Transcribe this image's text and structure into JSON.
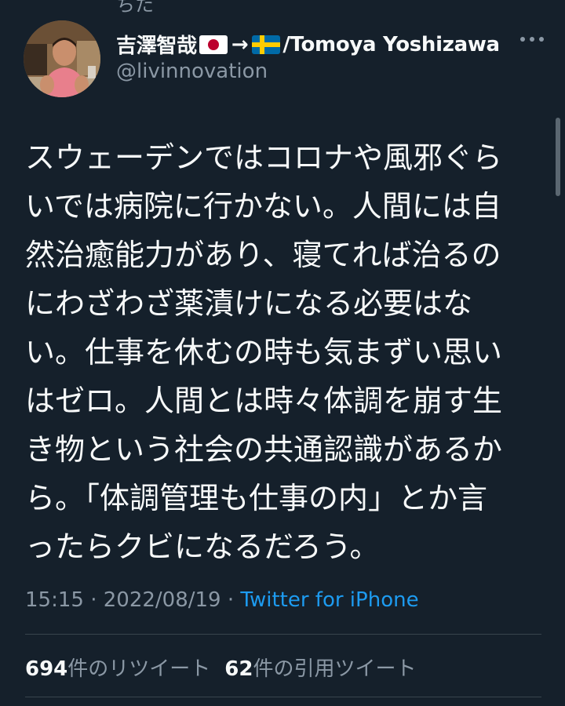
{
  "header": {
    "top_clipped_text": "ちた"
  },
  "author": {
    "name_prefix": "吉澤智哉",
    "arrow": "→",
    "name_suffix": "/Tomoya Yoshizawa",
    "handle": "@livinnovation",
    "flag_from": "japan-flag-icon",
    "flag_to": "sweden-flag-icon",
    "more_icon": "more-icon"
  },
  "tweet": {
    "lines": [
      "スウェーデンではコロナや風邪ぐら",
      "いでは病院に行かない。人間には自",
      "然治癒能力があり、寝てれば治るの",
      "にわざわざ薬漬けになる必要はな",
      "い。仕事を休むの時も気まずい思い",
      "はゼロ。人間とは時々体調を崩す生",
      "き物という社会の共通認識があるか",
      "ら。「体調管理も仕事の内」とか言",
      "ったらクビになるだろう。"
    ]
  },
  "meta": {
    "time": "15:15",
    "sep1": " · ",
    "date": "2022/08/19",
    "sep2": " · ",
    "source": "Twitter for iPhone"
  },
  "stats": {
    "retweets_count": "694",
    "retweets_label": "件のリツイート",
    "quotes_count": "62",
    "quotes_label": "件の引用ツイート"
  },
  "colors": {
    "background": "#15202b",
    "text_primary": "#f7f9f9",
    "text_secondary": "#8b98a5",
    "link": "#1d9bf0",
    "divider": "#38444d"
  }
}
